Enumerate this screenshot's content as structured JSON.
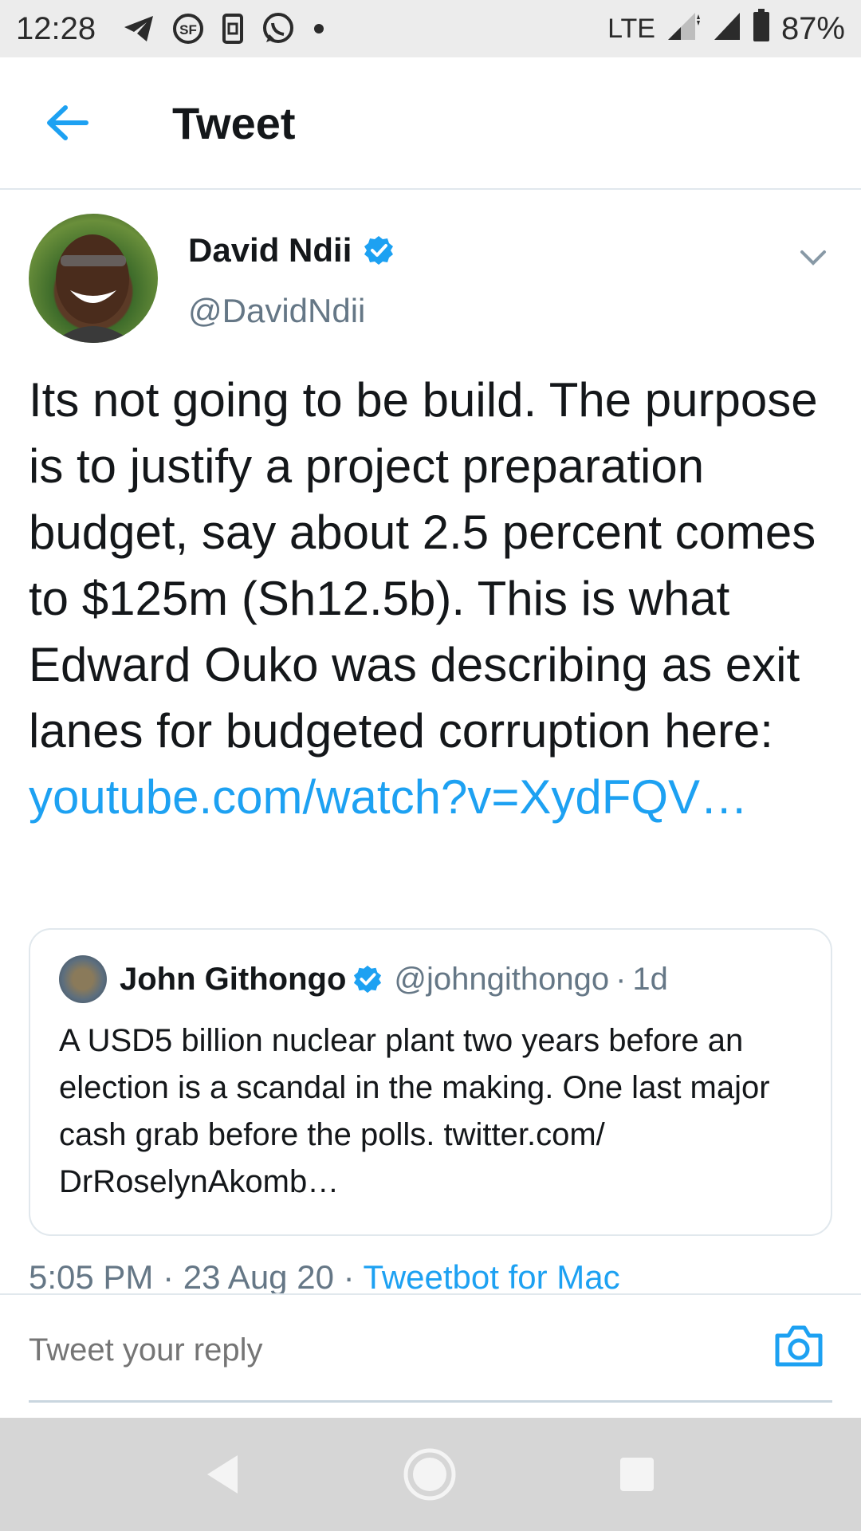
{
  "status_bar": {
    "time": "12:28",
    "icons": [
      "telegram-icon",
      "news-icon",
      "sim-icon",
      "whatsapp-icon",
      "dot-icon"
    ],
    "network": "LTE",
    "battery_percent": "87%"
  },
  "header": {
    "title": "Tweet",
    "back_icon": "arrow-left-icon"
  },
  "tweet": {
    "author_name": "David Ndii",
    "author_handle": "@DavidNdii",
    "verified": true,
    "text": "Its not going to be build. The purpose is to justify a project preparation budget, say about 2.5 percent comes to $125m (Sh12.5b). This is what Edward Ouko was describing as exit lanes for budgeted corruption here:",
    "link_text": "youtube.com/watch?v=XydFQV…",
    "timestamp": "5:05 PM · 23 Aug 20 · ",
    "source": "Tweetbot for Mac"
  },
  "quoted_tweet": {
    "author_name": "John Githongo",
    "author_handle": "@johngithongo",
    "separator": "·",
    "age": "1d",
    "text": "A USD5 billion nuclear plant two years before an election is a scandal in the making. One last major cash grab before the polls. twitter.com/ DrRoselynAkomb…"
  },
  "reply": {
    "placeholder": "Tweet your reply",
    "camera_icon": "camera-icon"
  },
  "nav": {
    "buttons": [
      "back-triangle-icon",
      "home-circle-icon",
      "recents-square-icon"
    ]
  },
  "colors": {
    "accent": "#1da1f2",
    "secondary_text": "#657786",
    "divider": "#e1e8ed"
  }
}
